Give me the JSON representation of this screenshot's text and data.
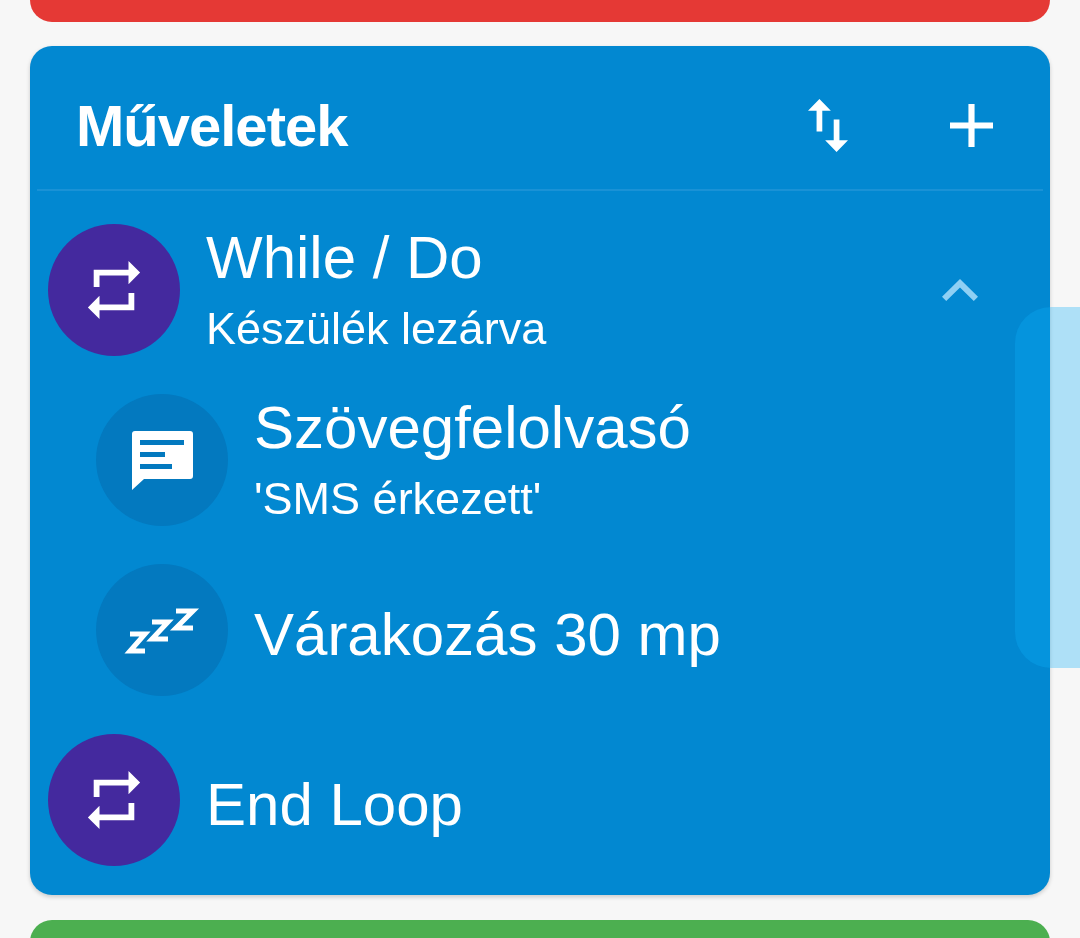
{
  "section": {
    "title": "Műveletek"
  },
  "actions": [
    {
      "kind": "loop",
      "title": "While / Do",
      "subtitle": "Készülék lezárva",
      "expanded": true,
      "children": [
        {
          "kind": "speech",
          "title": "Szövegfelolvasó",
          "subtitle": "'SMS érkezett'"
        },
        {
          "kind": "wait",
          "title": "Várakozás 30 mp"
        }
      ]
    },
    {
      "kind": "loop",
      "title": "End Loop"
    }
  ]
}
